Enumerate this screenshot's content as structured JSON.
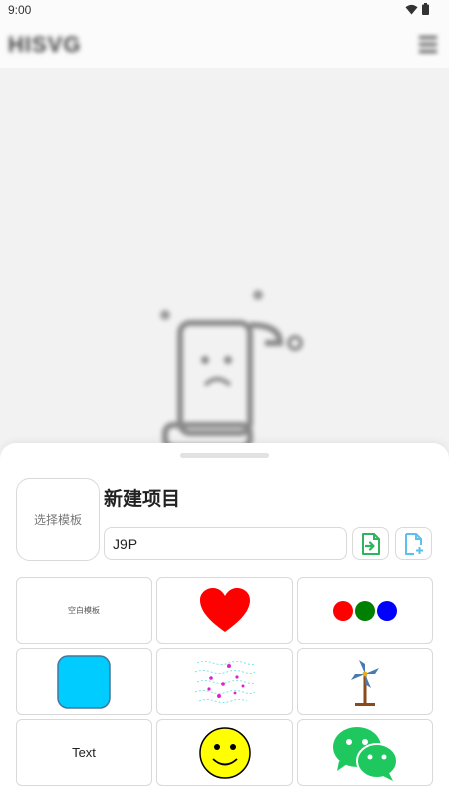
{
  "status_bar": {
    "time": "9:00",
    "icons": [
      "wifi-icon",
      "battery-icon"
    ]
  },
  "app_bar": {
    "title": "HISVG",
    "menu_icon": "menu-icon"
  },
  "sheet": {
    "template_picker_label": "选择模板",
    "title": "新建项目",
    "project_name_value": "J9P",
    "import_icon": "import-file-icon",
    "new_file_icon": "new-file-icon",
    "templates": [
      {
        "label": "空白模板",
        "icon": "blank-template"
      },
      {
        "label": "",
        "icon": "heart-icon"
      },
      {
        "label": "",
        "icon": "three-dots-icon"
      },
      {
        "label": "",
        "icon": "rounded-square-icon"
      },
      {
        "label": "",
        "icon": "particles-icon"
      },
      {
        "label": "",
        "icon": "windmill-icon"
      },
      {
        "label": "Text",
        "icon": "text-template"
      },
      {
        "label": "",
        "icon": "smiley-icon"
      },
      {
        "label": "",
        "icon": "wechat-icon"
      }
    ]
  },
  "colors": {
    "accent_green": "#2fb35c",
    "accent_blue": "#5bc0eb",
    "heart_red": "#ff0000",
    "square_cyan": "#00ccff",
    "smiley_yellow": "#ffff00",
    "wechat_green": "#1fc85f"
  }
}
